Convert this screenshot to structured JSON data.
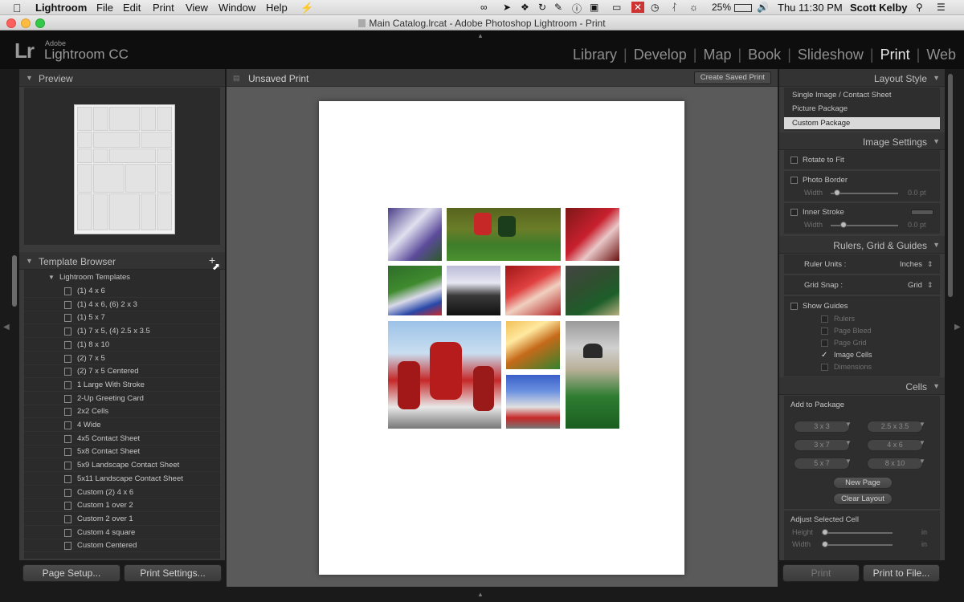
{
  "menubar": {
    "app": "Lightroom",
    "items": [
      "File",
      "Edit",
      "Print",
      "View",
      "Window",
      "Help"
    ],
    "battery": "25%",
    "clock": "Thu 11:30 PM",
    "user": "Scott Kelby"
  },
  "window": {
    "title": "Main Catalog.lrcat - Adobe Photoshop Lightroom - Print"
  },
  "brand": {
    "mark": "Lr",
    "company": "Adobe",
    "product": "Lightroom CC"
  },
  "modules": [
    {
      "label": "Library",
      "active": false
    },
    {
      "label": "Develop",
      "active": false
    },
    {
      "label": "Map",
      "active": false
    },
    {
      "label": "Book",
      "active": false
    },
    {
      "label": "Slideshow",
      "active": false
    },
    {
      "label": "Print",
      "active": true
    },
    {
      "label": "Web",
      "active": false
    }
  ],
  "left": {
    "preview_title": "Preview",
    "template_title": "Template Browser",
    "add_icon": "+",
    "folder": "Lightroom Templates",
    "templates": [
      "(1) 4 x 6",
      "(1) 4 x 6, (6) 2 x 3",
      "(1) 5 x 7",
      "(1) 7 x 5, (4) 2.5 x 3.5",
      "(1) 8 x 10",
      "(2) 7 x 5",
      "(2) 7 x 5 Centered",
      "1 Large With Stroke",
      "2-Up Greeting Card",
      "2x2 Cells",
      "4 Wide",
      "4x5 Contact Sheet",
      "5x8 Contact Sheet",
      "5x9 Landscape Contact Sheet",
      "5x11 Landscape Contact Sheet",
      "Custom (2) 4 x 6",
      "Custom 1 over 2",
      "Custom 2 over 1",
      "Custom 4 square",
      "Custom Centered"
    ],
    "page_setup": "Page Setup...",
    "print_settings": "Print Settings..."
  },
  "center": {
    "title": "Unsaved Print",
    "create_saved": "Create Saved Print"
  },
  "right": {
    "layout_style": {
      "title": "Layout Style",
      "options": [
        "Single Image / Contact Sheet",
        "Picture Package",
        "Custom Package"
      ],
      "selected": 2
    },
    "image_settings": {
      "title": "Image Settings",
      "rotate": "Rotate to Fit",
      "photo_border": "Photo Border",
      "inner_stroke": "Inner Stroke",
      "width_label": "Width",
      "width_value": "0.0 pt"
    },
    "rulers": {
      "title": "Rulers, Grid & Guides",
      "ruler_units_label": "Ruler Units :",
      "ruler_units_value": "Inches",
      "grid_snap_label": "Grid Snap :",
      "grid_snap_value": "Grid",
      "show_guides": "Show Guides",
      "guides": [
        {
          "label": "Rulers",
          "checked": false
        },
        {
          "label": "Page Bleed",
          "checked": false
        },
        {
          "label": "Page Grid",
          "checked": false
        },
        {
          "label": "Image Cells",
          "checked": true
        },
        {
          "label": "Dimensions",
          "checked": false
        }
      ]
    },
    "cells": {
      "title": "Cells",
      "add_to_package": "Add to Package",
      "sizes": [
        "3 x 3",
        "2.5 x 3.5",
        "3 x 7",
        "4 x 6",
        "5 x 7",
        "8 x 10"
      ],
      "new_page": "New Page",
      "clear_layout": "Clear Layout",
      "adjust_cell": "Adjust Selected Cell",
      "height_label": "Height",
      "width_label": "Width",
      "unit": "in"
    },
    "print_btn": "Print",
    "print_to_file": "Print to File..."
  },
  "colors": {
    "panel": "#3a3a3a",
    "panel_inner": "#2b2b2b",
    "canvas": "#5a5a5a",
    "selected": "#d9d9d9",
    "accent_red": "#c8202e",
    "accent_green": "#2e7d32"
  },
  "icons": {
    "apple": "apple-icon",
    "search": "search-icon",
    "collapse": "disclosure-triangle-icon",
    "template": "template-icon"
  }
}
